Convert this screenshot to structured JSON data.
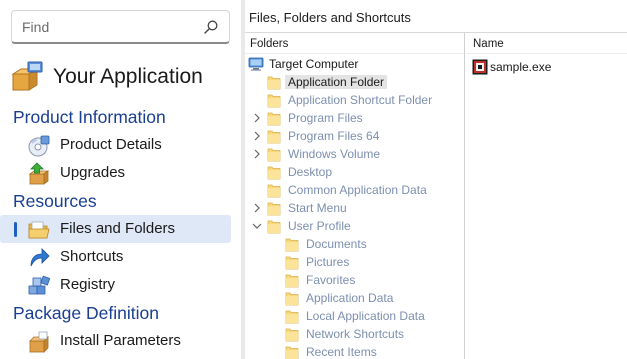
{
  "search": {
    "placeholder": "Find"
  },
  "app": {
    "title": "Your Application"
  },
  "sections": {
    "product_information": "Product Information",
    "resources": "Resources",
    "package_definition": "Package Definition"
  },
  "nav": {
    "product_details": "Product Details",
    "upgrades": "Upgrades",
    "files_and_folders": "Files and Folders",
    "shortcuts": "Shortcuts",
    "registry": "Registry",
    "install_parameters": "Install Parameters"
  },
  "panel": {
    "title": "Files, Folders and Shortcuts",
    "folders_header": "Folders",
    "name_header": "Name"
  },
  "tree": {
    "root": "Target Computer",
    "items": [
      "Application Folder",
      "Application Shortcut Folder",
      "Program Files",
      "Program Files 64",
      "Windows Volume",
      "Desktop",
      "Common Application Data",
      "Start Menu",
      "User Profile",
      "Documents",
      "Pictures",
      "Favorites",
      "Application Data",
      "Local Application Data",
      "Network Shortcuts",
      "Recent Items"
    ]
  },
  "files": [
    {
      "name": "sample.exe",
      "icon": "exe-file-icon"
    }
  ],
  "colors": {
    "section": "#1a3f91",
    "accent": "#1f5fbf",
    "selected_bg": "#dfe8f6",
    "muted_item": "#7d8fb0"
  }
}
